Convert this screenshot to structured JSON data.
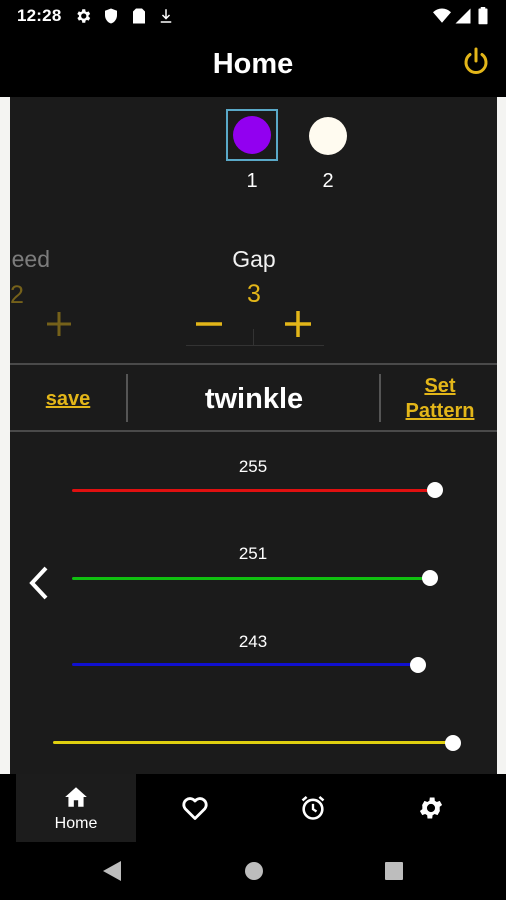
{
  "status_bar": {
    "time": "12:28",
    "icons": [
      "gear-icon",
      "shield-icon",
      "sim-card-icon",
      "download-icon",
      "wifi-icon",
      "signal-icon",
      "battery-icon"
    ]
  },
  "app_bar": {
    "title": "Home",
    "power_icon": "power-icon"
  },
  "colors": {
    "accent": "#e3b619",
    "background": "#1b1b1b",
    "swatch_1": "#9200f0",
    "swatch_2": "#fffbf0",
    "red": "#e01010",
    "green": "#10c010",
    "blue": "#1010d0",
    "yellow": "#e0d010"
  },
  "swatches": [
    {
      "label": "1",
      "selected": true
    },
    {
      "label": "2",
      "selected": false
    }
  ],
  "params": {
    "speed": {
      "label": "Speed",
      "visible_label": "eed",
      "value": "2"
    },
    "gap": {
      "label": "Gap",
      "value": "3"
    }
  },
  "pattern_bar": {
    "save_label": "save",
    "pattern_name": "twinkle",
    "set_pattern_line1": "Set",
    "set_pattern_line2": "Pattern"
  },
  "sliders": {
    "red": {
      "value": "255"
    },
    "green": {
      "value": "251"
    },
    "blue": {
      "value": "243"
    },
    "brightness": {
      "level": 1.0
    }
  },
  "tabs": [
    {
      "label": "Home",
      "icon": "home-icon",
      "active": true
    },
    {
      "label": "",
      "icon": "heart-icon",
      "active": false
    },
    {
      "label": "",
      "icon": "alarm-clock-icon",
      "active": false
    },
    {
      "label": "",
      "icon": "gear-icon",
      "active": false
    }
  ],
  "nav_bar": {
    "icons": [
      "back-triangle-icon",
      "home-circle-icon",
      "recents-square-icon"
    ]
  }
}
